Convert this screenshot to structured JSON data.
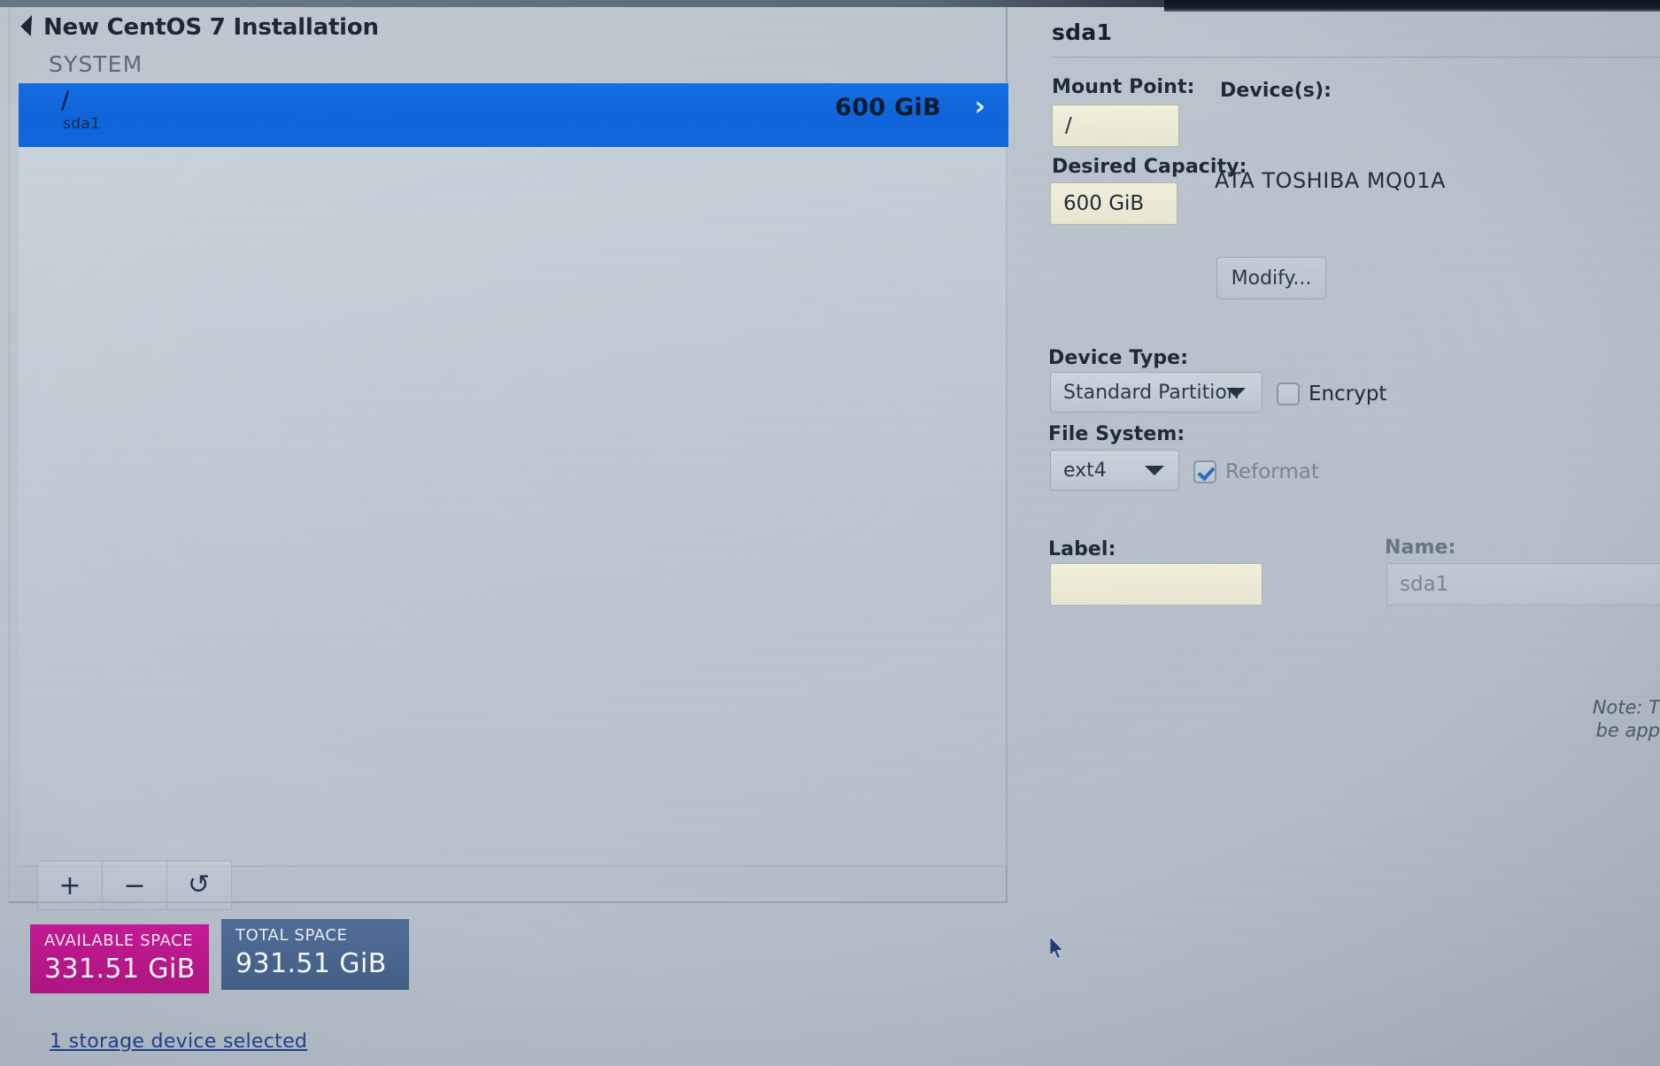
{
  "left_panel": {
    "page_title": "New CentOS 7 Installation",
    "group_header": "SYSTEM",
    "partitions": [
      {
        "mount_point": "/",
        "device_name": "sda1",
        "size": "600 GiB",
        "chevron": "›",
        "selected": true
      }
    ],
    "toolbar": {
      "add_label": "+",
      "remove_label": "−",
      "refresh_label": "↻"
    },
    "available_space": {
      "caption": "AVAILABLE SPACE",
      "value": "331.51 GiB",
      "color": "#c0188f"
    },
    "total_space": {
      "caption": "TOTAL SPACE",
      "value": "931.51 GiB",
      "color": "#4a6a97"
    },
    "storage_link": "1 storage device selected"
  },
  "right_panel": {
    "title": "sda1",
    "mount_point": {
      "label": "Mount Point:",
      "value": "/"
    },
    "desired_capacity": {
      "label": "Desired Capacity:",
      "value": "600 GiB"
    },
    "devices": {
      "label": "Device(s):",
      "value": "ATA TOSHIBA MQ01A",
      "modify_button": "Modify..."
    },
    "device_type": {
      "label": "Device Type:",
      "value": "Standard Partition"
    },
    "encrypt": {
      "label": "Encrypt",
      "checked": false
    },
    "file_system": {
      "label": "File System:",
      "value": "ext4"
    },
    "reformat": {
      "label": "Reformat",
      "checked": true
    },
    "label_field": {
      "label": "Label:",
      "value": ""
    },
    "name_field": {
      "label": "Name:",
      "value": "sda1"
    },
    "note": {
      "line1": "Note: T",
      "line2": "be app"
    }
  },
  "colors": {
    "selection_blue": "#0f6ae0",
    "accent_magenta": "#c0188f",
    "accent_slate": "#4a6a97",
    "link_blue": "#21438f"
  }
}
